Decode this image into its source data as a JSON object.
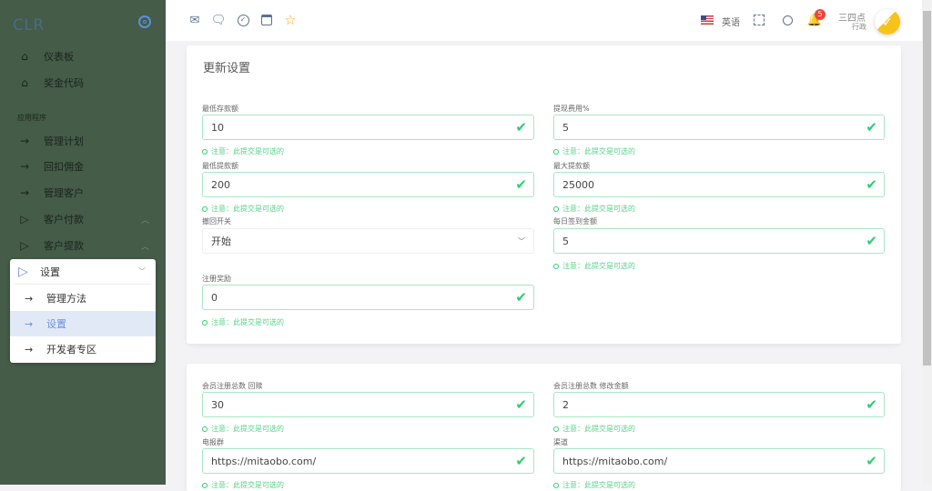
{
  "sidebar": {
    "logo": "CLR",
    "section": "应用程序",
    "items": [
      {
        "label": "仪表板",
        "icon": "home-icon"
      },
      {
        "label": "奖金代码",
        "icon": "home-icon"
      },
      {
        "label": "管理计划",
        "icon": "arrow-right-icon"
      },
      {
        "label": "回扣佣金",
        "icon": "arrow-right-icon"
      },
      {
        "label": "管理客户",
        "icon": "arrow-right-icon"
      },
      {
        "label": "客户付款",
        "icon": "play-icon"
      },
      {
        "label": "客户提款",
        "icon": "play-icon"
      }
    ],
    "settings": {
      "label": "设置",
      "children": [
        {
          "label": "管理方法"
        },
        {
          "label": "设置"
        },
        {
          "label": "开发者专区"
        }
      ]
    }
  },
  "topbar": {
    "language": "英语",
    "notifications": "5",
    "user_name": "三四点",
    "user_role": "行政"
  },
  "card1": {
    "title": "更新设置",
    "note": "注意：此提交是可选的",
    "fields": [
      {
        "label": "最低存款额",
        "value": "10"
      },
      {
        "label": "提现费用%",
        "value": "5"
      },
      {
        "label": "最低提款额",
        "value": "200"
      },
      {
        "label": "最大提款额",
        "value": "25000"
      },
      {
        "label": "撤回开关",
        "value": "开始"
      },
      {
        "label": "每日签到金额",
        "value": "5"
      },
      {
        "label": "注册奖励",
        "value": "0"
      }
    ]
  },
  "card2": {
    "fields": [
      {
        "label": "会员注册总数 回赎",
        "value": "30"
      },
      {
        "label": "会员注册总数 修改金额",
        "value": "2"
      },
      {
        "label": "电报群",
        "value": "https://mitaobo.com/"
      },
      {
        "label": "渠道",
        "value": "https://mitaobo.com/"
      }
    ]
  },
  "colors": {
    "sidebar": "#445c48",
    "success": "#2ecc71",
    "accent": "#6d8fd8",
    "badge": "#f44336"
  }
}
